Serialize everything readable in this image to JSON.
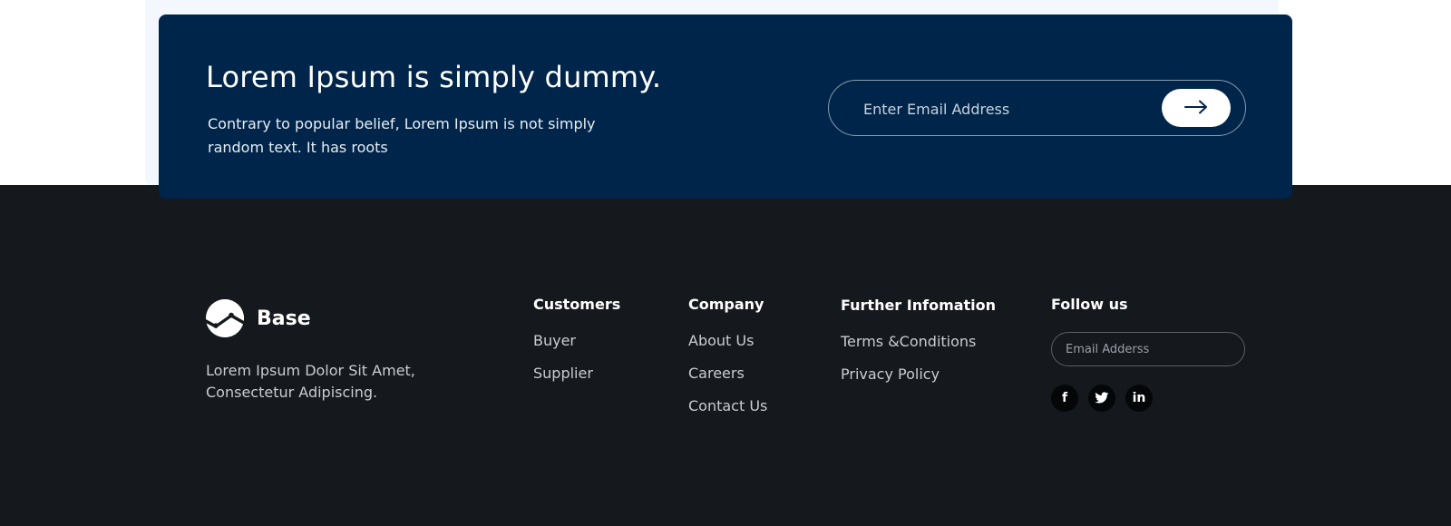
{
  "newsletter": {
    "title": "Lorem Ipsum is simply dummy.",
    "text": "Contrary to popular belief, Lorem Ipsum is not simply random text. It has roots",
    "email_placeholder": "Enter Email Address",
    "submit_icon": "arrow-right-icon"
  },
  "brand": {
    "logo_icon": "chart-logo-icon",
    "name": "Base",
    "description": "Lorem Ipsum Dolor Sit Amet, Consectetur Adipiscing."
  },
  "columns": {
    "customers": {
      "heading": "Customers",
      "links": [
        "Buyer",
        "Supplier"
      ]
    },
    "company": {
      "heading": "Company",
      "links": [
        "About Us",
        "Careers",
        "Contact Us"
      ]
    },
    "further": {
      "heading": "Further Infomation",
      "links": [
        "Terms &Conditions",
        "Privacy Policy"
      ]
    },
    "follow": {
      "heading": "Follow us",
      "email_placeholder": "Email Adderss",
      "socials": [
        {
          "icon": "facebook-icon",
          "glyph": "f"
        },
        {
          "icon": "twitter-icon",
          "glyph": "t"
        },
        {
          "icon": "linkedin-icon",
          "glyph": "in"
        }
      ]
    }
  },
  "colors": {
    "banner_bg": "#00254a",
    "footer_bg": "#15181c",
    "backdrop": "#f4f8fe"
  }
}
